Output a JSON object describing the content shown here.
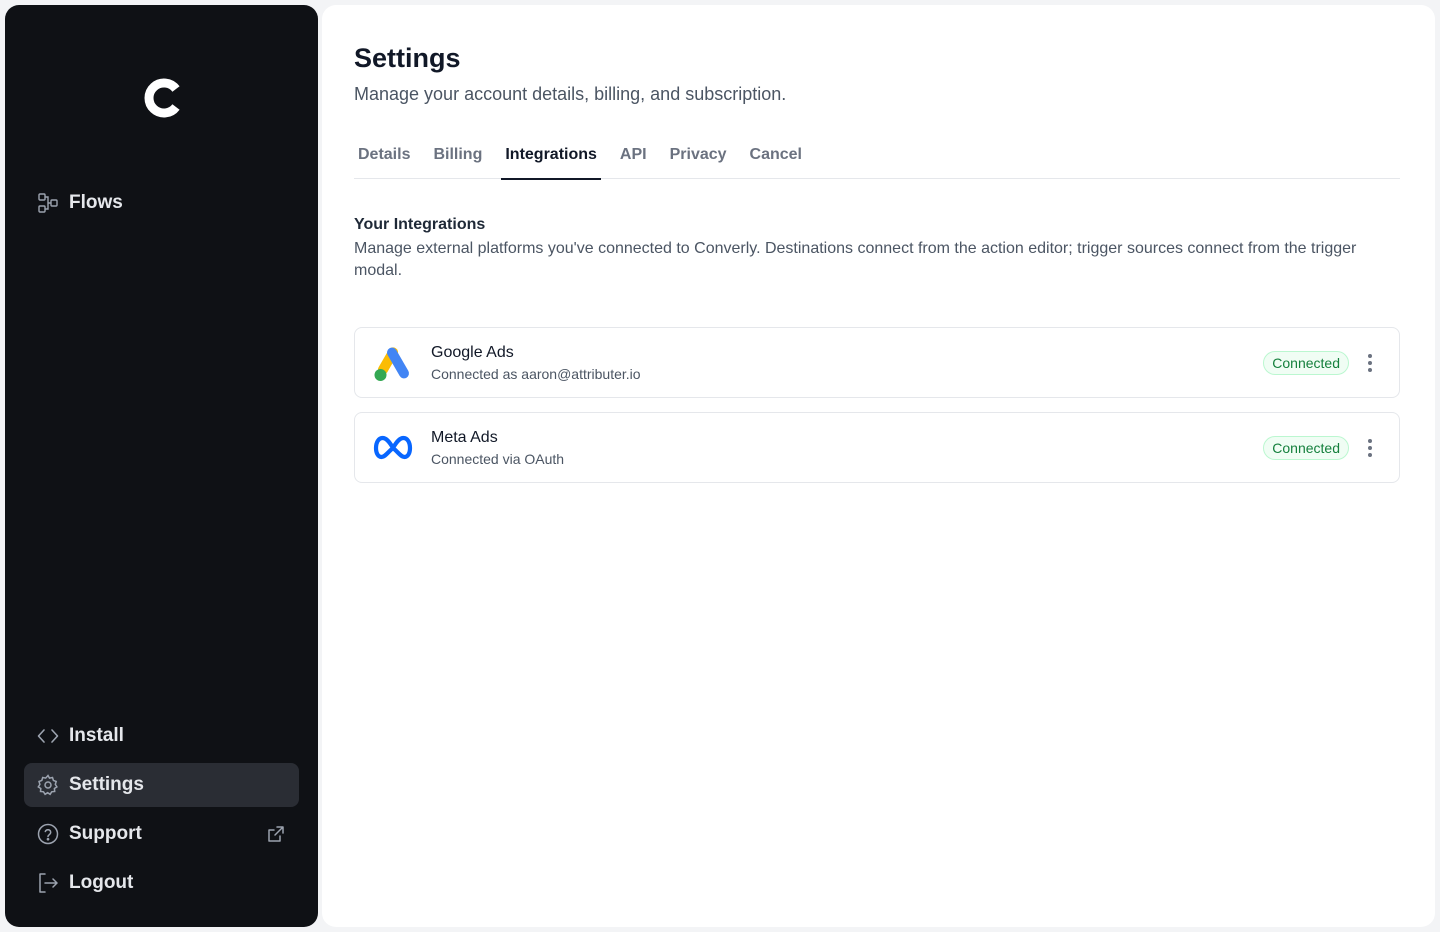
{
  "sidebar": {
    "logo_icon": "converly-logo-icon",
    "top_items": [
      {
        "label": "Flows",
        "icon": "flows-icon"
      }
    ],
    "bottom_items": [
      {
        "label": "Install",
        "icon": "code-icon"
      },
      {
        "label": "Settings",
        "icon": "gear-icon",
        "active": true
      },
      {
        "label": "Support",
        "icon": "help-circle-icon",
        "trailing_icon": "external-link-icon"
      },
      {
        "label": "Logout",
        "icon": "logout-icon"
      }
    ]
  },
  "page": {
    "title": "Settings",
    "subtitle": "Manage your account details, billing, and subscription."
  },
  "tabs": [
    {
      "label": "Details"
    },
    {
      "label": "Billing"
    },
    {
      "label": "Integrations",
      "active": true
    },
    {
      "label": "API"
    },
    {
      "label": "Privacy"
    },
    {
      "label": "Cancel"
    }
  ],
  "integrations_section": {
    "title": "Your Integrations",
    "description": "Manage external platforms you've connected to Converly. Destinations connect from the action editor; trigger sources connect from the trigger modal."
  },
  "integrations": [
    {
      "name": "Google Ads",
      "meta": "Connected as aaron@attributer.io",
      "status": "Connected",
      "icon": "google-ads-icon"
    },
    {
      "name": "Meta Ads",
      "meta": "Connected via OAuth",
      "status": "Connected",
      "icon": "meta-icon"
    }
  ],
  "colors": {
    "sidebar_bg": "#0f1115",
    "active_nav_bg": "#2a2d34",
    "status_green": "#15803d"
  }
}
